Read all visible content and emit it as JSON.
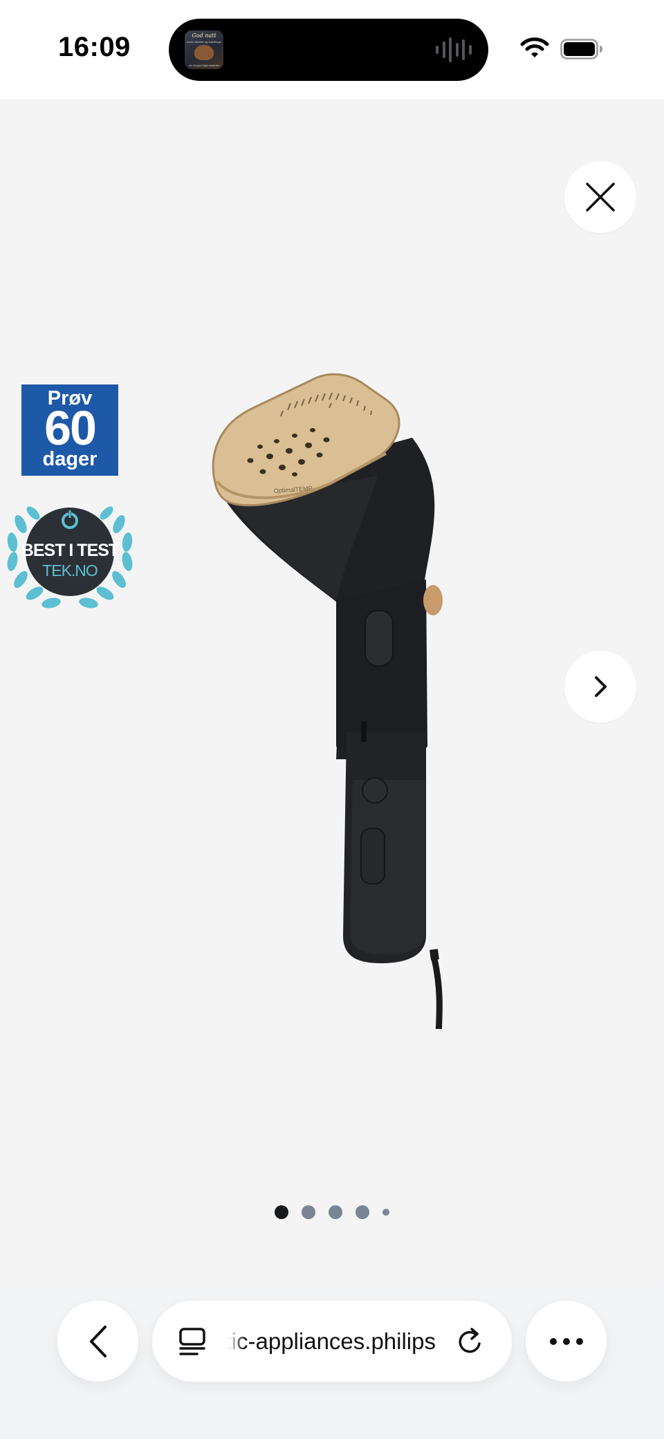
{
  "status_bar": {
    "time": "16:09",
    "now_playing": {
      "title": "God natt",
      "subtitle": "Korte historier og fortellinger",
      "footer": "Av Norges Bjørnefabrikk"
    }
  },
  "gallery": {
    "close_label": "Close",
    "next_label": "Next image",
    "dot_count": 5,
    "active_index": 0
  },
  "badges": {
    "trial": {
      "top": "Prøv",
      "number": "60",
      "bottom": "dager"
    },
    "award": {
      "line1": "BEST I TEST",
      "line2": "TEK.NO"
    }
  },
  "product": {
    "imprint": "OptimalTEMP",
    "colors": {
      "plate": "#d9bf93",
      "body": "#1c1d20",
      "button": "#c79b6c"
    }
  },
  "browser": {
    "url_display": "domestic-appliances.philips",
    "back_label": "Back",
    "more_label": "More"
  },
  "colors": {
    "background": "#f4f4f5",
    "trial_badge": "#1e59a8",
    "laurel": "#5cbfd2",
    "dot_active": "#16181c",
    "dot_inactive": "#7a8494"
  }
}
